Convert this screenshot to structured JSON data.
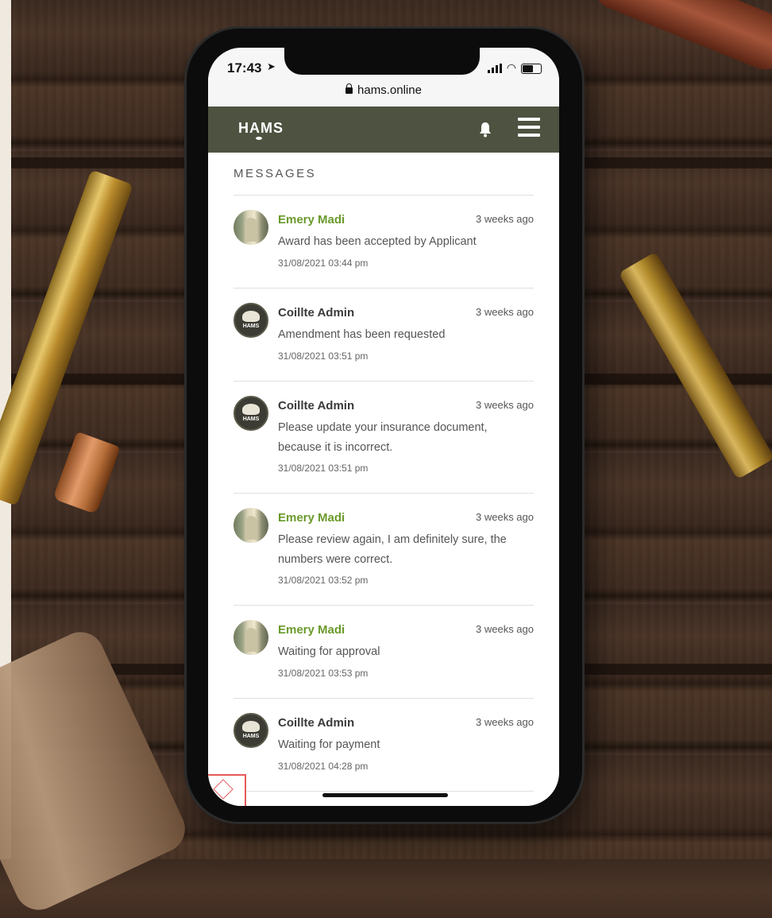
{
  "status_bar": {
    "time": "17:43",
    "url": "hams.online"
  },
  "header": {
    "logo": "HAMS"
  },
  "section_title": "MESSAGES",
  "messages": [
    {
      "sender": "Emery Madi",
      "type": "person",
      "ago": "3 weeks ago",
      "body": "Award has been accepted by Applicant",
      "date": "31/08/2021 03:44 pm"
    },
    {
      "sender": "Coillte Admin",
      "type": "org",
      "ago": "3 weeks ago",
      "body": "Amendment has been requested",
      "date": "31/08/2021 03:51 pm"
    },
    {
      "sender": "Coillte Admin",
      "type": "org",
      "ago": "3 weeks ago",
      "body": "Please update your insurance document, because it is incorrect.",
      "date": "31/08/2021 03:51 pm"
    },
    {
      "sender": "Emery Madi",
      "type": "person",
      "ago": "3 weeks ago",
      "body": "Please review again, I am definitely sure, the numbers were correct.",
      "date": "31/08/2021 03:52 pm"
    },
    {
      "sender": "Emery Madi",
      "type": "person",
      "ago": "3 weeks ago",
      "body": "Waiting for approval",
      "date": "31/08/2021 03:53 pm"
    },
    {
      "sender": "Coillte Admin",
      "type": "org",
      "ago": "3 weeks ago",
      "body": "Waiting for payment",
      "date": "31/08/2021 04:28 pm"
    }
  ],
  "org_avatar_label": "HAMS",
  "colors": {
    "header_bg": "#4d5340",
    "person_name": "#6a9a2a",
    "org_name": "#3a3a3a"
  }
}
